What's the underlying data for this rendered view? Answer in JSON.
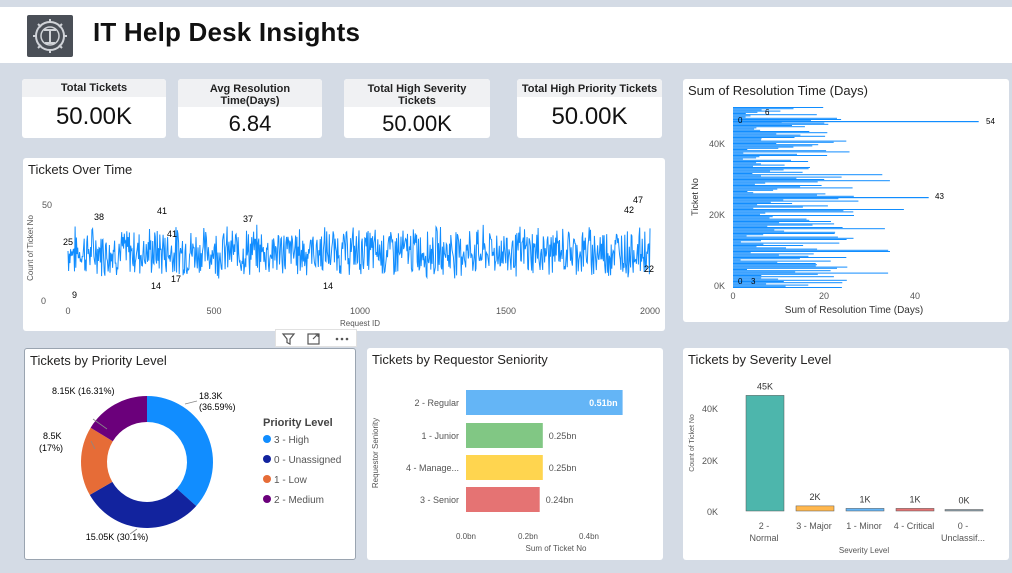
{
  "header": {
    "title": "IT Help Desk Insights"
  },
  "kpis": [
    {
      "label": "Total Tickets",
      "value": "50.00K"
    },
    {
      "label": "Avg Resolution Time(Days)",
      "value": "6.84"
    },
    {
      "label": "Total High Severity Tickets",
      "value": "50.00K"
    },
    {
      "label": "Total High Priority Tickets",
      "value": "50.00K"
    }
  ],
  "tickets_over_time": {
    "title": "Tickets Over Time",
    "ylabel": "Count of Ticket No",
    "xlabel": "Request ID",
    "yticks": [
      "0",
      "50"
    ],
    "xticks": [
      "0",
      "500",
      "1000",
      "1500",
      "2000"
    ],
    "annotations": [
      "25",
      "38",
      "41",
      "41",
      "37",
      "47",
      "42",
      "22",
      "9",
      "14",
      "17",
      "14"
    ],
    "color": "#118dff"
  },
  "resolution_time": {
    "title": "Sum of Resolution Time (Days)",
    "ylabel": "Ticket No",
    "xlabel": "Sum of Resolution Time (Days)",
    "yticks": [
      "0K",
      "20K",
      "40K"
    ],
    "xticks": [
      "0",
      "20",
      "40"
    ],
    "annotations": [
      "6",
      "0",
      "54",
      "43",
      "0",
      "3"
    ],
    "color": "#118dff"
  },
  "priority": {
    "title": "Tickets by Priority Level",
    "legend_title": "Priority Level",
    "slices": [
      {
        "label": "3 - High",
        "value": 18300,
        "display": "18.3K",
        "pct": "(36.59%)",
        "color": "#118dff"
      },
      {
        "label": "0 - Unassigned",
        "value": 15050,
        "display": "15.05K (30.1%)",
        "pct": "",
        "color": "#12239e"
      },
      {
        "label": "1 - Low",
        "value": 8500,
        "display": "8.5K",
        "pct": "(17%)",
        "color": "#e66c37"
      },
      {
        "label": "2 - Medium",
        "value": 8150,
        "display": "8.15K (16.31%)",
        "pct": "",
        "color": "#6b007b"
      }
    ]
  },
  "seniority": {
    "title": "Tickets by Requestor Seniority",
    "ylabel": "Requestor Seniority",
    "xlabel": "Sum of Ticket No",
    "xticks": [
      "0.0bn",
      "0.2bn",
      "0.4bn"
    ],
    "bars": [
      {
        "label": "2 - Regular",
        "value": 0.51,
        "display": "0.51bn",
        "color": "#64b5f6"
      },
      {
        "label": "1 - Junior",
        "value": 0.25,
        "display": "0.25bn",
        "color": "#81c784"
      },
      {
        "label": "4 - Manage...",
        "value": 0.25,
        "display": "0.25bn",
        "color": "#ffd54f"
      },
      {
        "label": "3 - Senior",
        "value": 0.24,
        "display": "0.24bn",
        "color": "#e57373"
      }
    ]
  },
  "severity": {
    "title": "Tickets by Severity Level",
    "ylabel": "Count of Ticket No",
    "xlabel": "Severity Level",
    "yticks": [
      "0K",
      "20K",
      "40K"
    ],
    "bars": [
      {
        "label": "2 -",
        "label2": "Normal",
        "value": 45000,
        "display": "45K",
        "color": "#4db6ac"
      },
      {
        "label": "3 - Major",
        "label2": "",
        "value": 2000,
        "display": "2K",
        "color": "#ffb74d"
      },
      {
        "label": "1 - Minor",
        "label2": "",
        "value": 1000,
        "display": "1K",
        "color": "#64b5f6"
      },
      {
        "label": "4 - Critical",
        "label2": "",
        "value": 1000,
        "display": "1K",
        "color": "#e57373"
      },
      {
        "label": "0 -",
        "label2": "Unclassif...",
        "value": 0,
        "display": "0K",
        "color": "#90a4ae"
      }
    ]
  },
  "chart_data": [
    {
      "type": "line",
      "title": "Tickets Over Time",
      "xlabel": "Request ID",
      "ylabel": "Count of Ticket No",
      "xlim": [
        0,
        2000
      ],
      "ylim": [
        0,
        50
      ],
      "series": [
        {
          "values_min": 9,
          "values_max": 47
        }
      ]
    },
    {
      "type": "bar",
      "title": "Sum of Resolution Time (Days)",
      "xlabel": "Sum of Resolution Time (Days)",
      "ylabel": "Ticket No",
      "xlim": [
        0,
        54
      ],
      "ylim": [
        0,
        50000
      ]
    },
    {
      "type": "pie",
      "title": "Tickets by Priority Level",
      "categories": [
        "3 - High",
        "0 - Unassigned",
        "1 - Low",
        "2 - Medium"
      ],
      "values": [
        18300,
        15050,
        8500,
        8150
      ]
    },
    {
      "type": "bar",
      "title": "Tickets by Requestor Seniority",
      "categories": [
        "2 - Regular",
        "1 - Junior",
        "4 - Manage...",
        "3 - Senior"
      ],
      "values": [
        0.51,
        0.25,
        0.25,
        0.24
      ],
      "xlabel": "Sum of Ticket No",
      "ylabel": "Requestor Seniority"
    },
    {
      "type": "bar",
      "title": "Tickets by Severity Level",
      "categories": [
        "2 - Normal",
        "3 - Major",
        "1 - Minor",
        "4 - Critical",
        "0 - Unclassif..."
      ],
      "values": [
        45000,
        2000,
        1000,
        1000,
        0
      ],
      "xlabel": "Severity Level",
      "ylabel": "Count of Ticket No"
    }
  ]
}
